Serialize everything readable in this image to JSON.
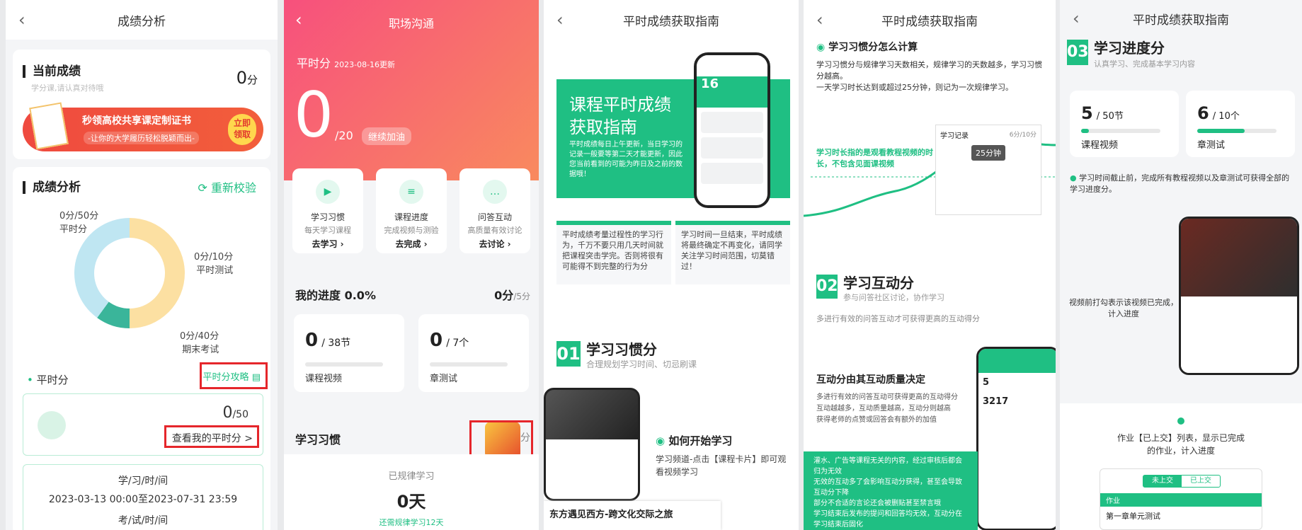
{
  "panels": {
    "p1": {
      "nav_title": "成绩分析",
      "current": {
        "title": "当前成绩",
        "subtitle": "学分课,请认真对待哦",
        "score": "0",
        "unit": "分"
      },
      "banner": {
        "title": "秒领高校共享课定制证书",
        "subtitle": "-让你的大学履历轻松脱颖而出-",
        "btn": "立即领取"
      },
      "analysis": {
        "title": "成绩分析",
        "recheck": "重新校验",
        "slices": [
          {
            "label": "平时分",
            "score": "0分",
            "max": "/50分",
            "value": 50,
            "color": "#fce0a2"
          },
          {
            "label": "平时测试",
            "score": "0分",
            "max": "/10分",
            "value": 10,
            "color": "#3ab59a"
          },
          {
            "label": "期末考试",
            "score": "0分",
            "max": "/40分",
            "value": 40,
            "color": "#bfe6f2"
          }
        ]
      },
      "pingshi": {
        "label": "平时分",
        "strategy": "平时分攻略",
        "score": "0",
        "max": "/50",
        "view": "查看我的平时分 >"
      },
      "times": {
        "study_label": "学/习/时/间",
        "study_value": "2023-03-13  00:00至2023-07-31  23:59",
        "exam_label": "考/试/时/间"
      }
    },
    "p2": {
      "nav_title": "职场沟通",
      "header": {
        "label": "平时分",
        "date": "2023-08-16更新",
        "score": "0",
        "max": "/20",
        "tag": "继续加油"
      },
      "cards": [
        {
          "title": "学习习惯",
          "sub": "每天学习课程",
          "action": "去学习 ›"
        },
        {
          "title": "课程进度",
          "sub": "完成视频与测验",
          "action": "去完成 ›"
        },
        {
          "title": "问答互动",
          "sub": "高质量有效讨论",
          "action": "去讨论 ›"
        }
      ],
      "progress": {
        "title": "我的进度",
        "pct": "0.0%",
        "score": "0分",
        "max": "/5分"
      },
      "stats": [
        {
          "num": "0",
          "den": "/ 38节",
          "label": "课程视频"
        },
        {
          "num": "0",
          "den": "/ 7个",
          "label": "章测试"
        }
      ],
      "habit": {
        "title": "学习习惯",
        "score_tail": "分",
        "regular": "已规律学习",
        "days": "0天",
        "hint": "还需规律学习12天"
      }
    },
    "p3": {
      "nav_title": "平时成绩获取指南",
      "hero_title_1": "课程平时成绩",
      "hero_title_2": "获取指南",
      "hero_desc": "平时成绩每日上午更新，当日学习的记录一般要等第二天才能更新，因此您当前看到的可能为昨日及之前的数据哦！",
      "phone_num": "16",
      "tip_left": "平时成绩考量过程性的学习行为，千万不要只用几天时间就把课程突击学完。否则将很有可能得不到完整的行为分",
      "tip_right": "学习时间一旦结束，平时成绩将最终确定不再变化，请同学关注学习时间范围，切莫错过！",
      "sec_num": "01",
      "sec_title": "学习习惯分",
      "sec_sub": "合理规划学习时间、切忌刷课",
      "how_title": "如何开始学习",
      "how_desc": "学习频道-点击【课程卡片】即可观看视频学习",
      "course_card": "东方遇见西方-跨文化交际之旅"
    },
    "p4": {
      "nav_title": "平时成绩获取指南",
      "calc_title": "学习习惯分怎么计算",
      "calc_desc_1": "学习习惯分与规律学习天数相关，规律学习的天数越多，学习习惯分越高。",
      "calc_desc_2": "一天学习时长达到或超过25分钟，则记为一次规律学习。",
      "record_label": "学习记录",
      "record_value": "6分/10分",
      "bubble": "25分钟",
      "note": "学习时长指的是观看教程视频的时长，不包含见面课视频",
      "sec_num": "02",
      "sec_title": "学习互动分",
      "sec_sub": "参与问答社区讨论，协作学习",
      "sec_desc": "多进行有效的问答互动才可获得更高的互动得分",
      "quality_title": "互动分由其互动质量决定",
      "bullets": [
        "多进行有效的问答互动可获得更高的互动得分",
        "互动越越多，互动质量越高，互动分则越高",
        "获得老师的点赞或回答会有额外的加值"
      ],
      "green_box": "灌水、广告等课程无关的内容，经过审核后都会归为无效\n无效的互动多了会影响互动分获得，甚至会导致互动分下降\n部分不合适的言论还会被删贴甚至禁言哦\n学习结束后发布的提问和回答均无效，互动分在学习结束后固化",
      "phone_nums": [
        "5",
        "3217"
      ]
    },
    "p5": {
      "nav_title": "平时成绩获取指南",
      "sec_num": "03",
      "sec_title": "学习进度分",
      "sec_sub": "认真学习、完成基本学习内容",
      "stats": [
        {
          "num": "5",
          "den": "/ 50节",
          "label": "课程视频",
          "fill": 0.1
        },
        {
          "num": "6",
          "den": "/ 10个",
          "label": "章测试",
          "fill": 0.6
        }
      ],
      "note": "学习时间截止前，完成所有教程视频以及章测试可获得全部的学习进度分。",
      "video_note": "视频前打勾表示该视频已完成，计入进度",
      "homework_note": "作业【已上交】列表，显示已完成的作业，计入进度",
      "tabs": [
        "未上交",
        "已上交"
      ],
      "homework_row_label": "作业",
      "homework_row_title": "第一章单元测试"
    }
  }
}
